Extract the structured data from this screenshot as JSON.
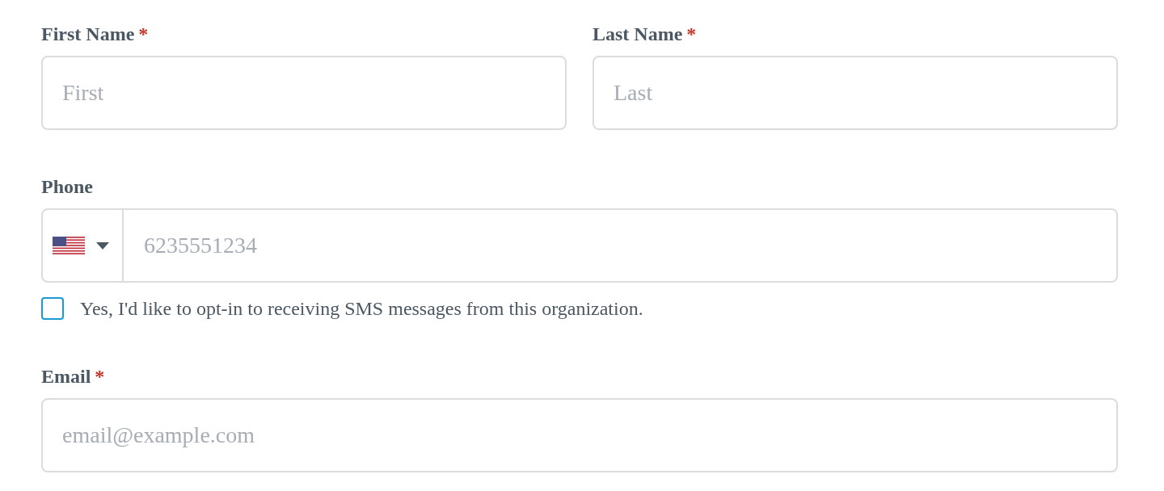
{
  "form": {
    "rows": [
      {
        "fields": [
          {
            "kind": "text",
            "label": "First Name",
            "required_mark": "*",
            "placeholder": "First"
          },
          {
            "kind": "text",
            "label": "Last Name",
            "required_mark": "*",
            "placeholder": "Last"
          }
        ]
      },
      {
        "fields": [
          {
            "kind": "phone",
            "label": "Phone",
            "placeholder": "6235551234",
            "opt_in": {
              "label": "Yes, I'd like to opt-in to receiving SMS messages from this organization.",
              "checked": false
            }
          }
        ]
      },
      {
        "fields": [
          {
            "kind": "text",
            "label": "Email",
            "required_mark": "*",
            "placeholder": "email@example.com"
          }
        ]
      }
    ]
  }
}
